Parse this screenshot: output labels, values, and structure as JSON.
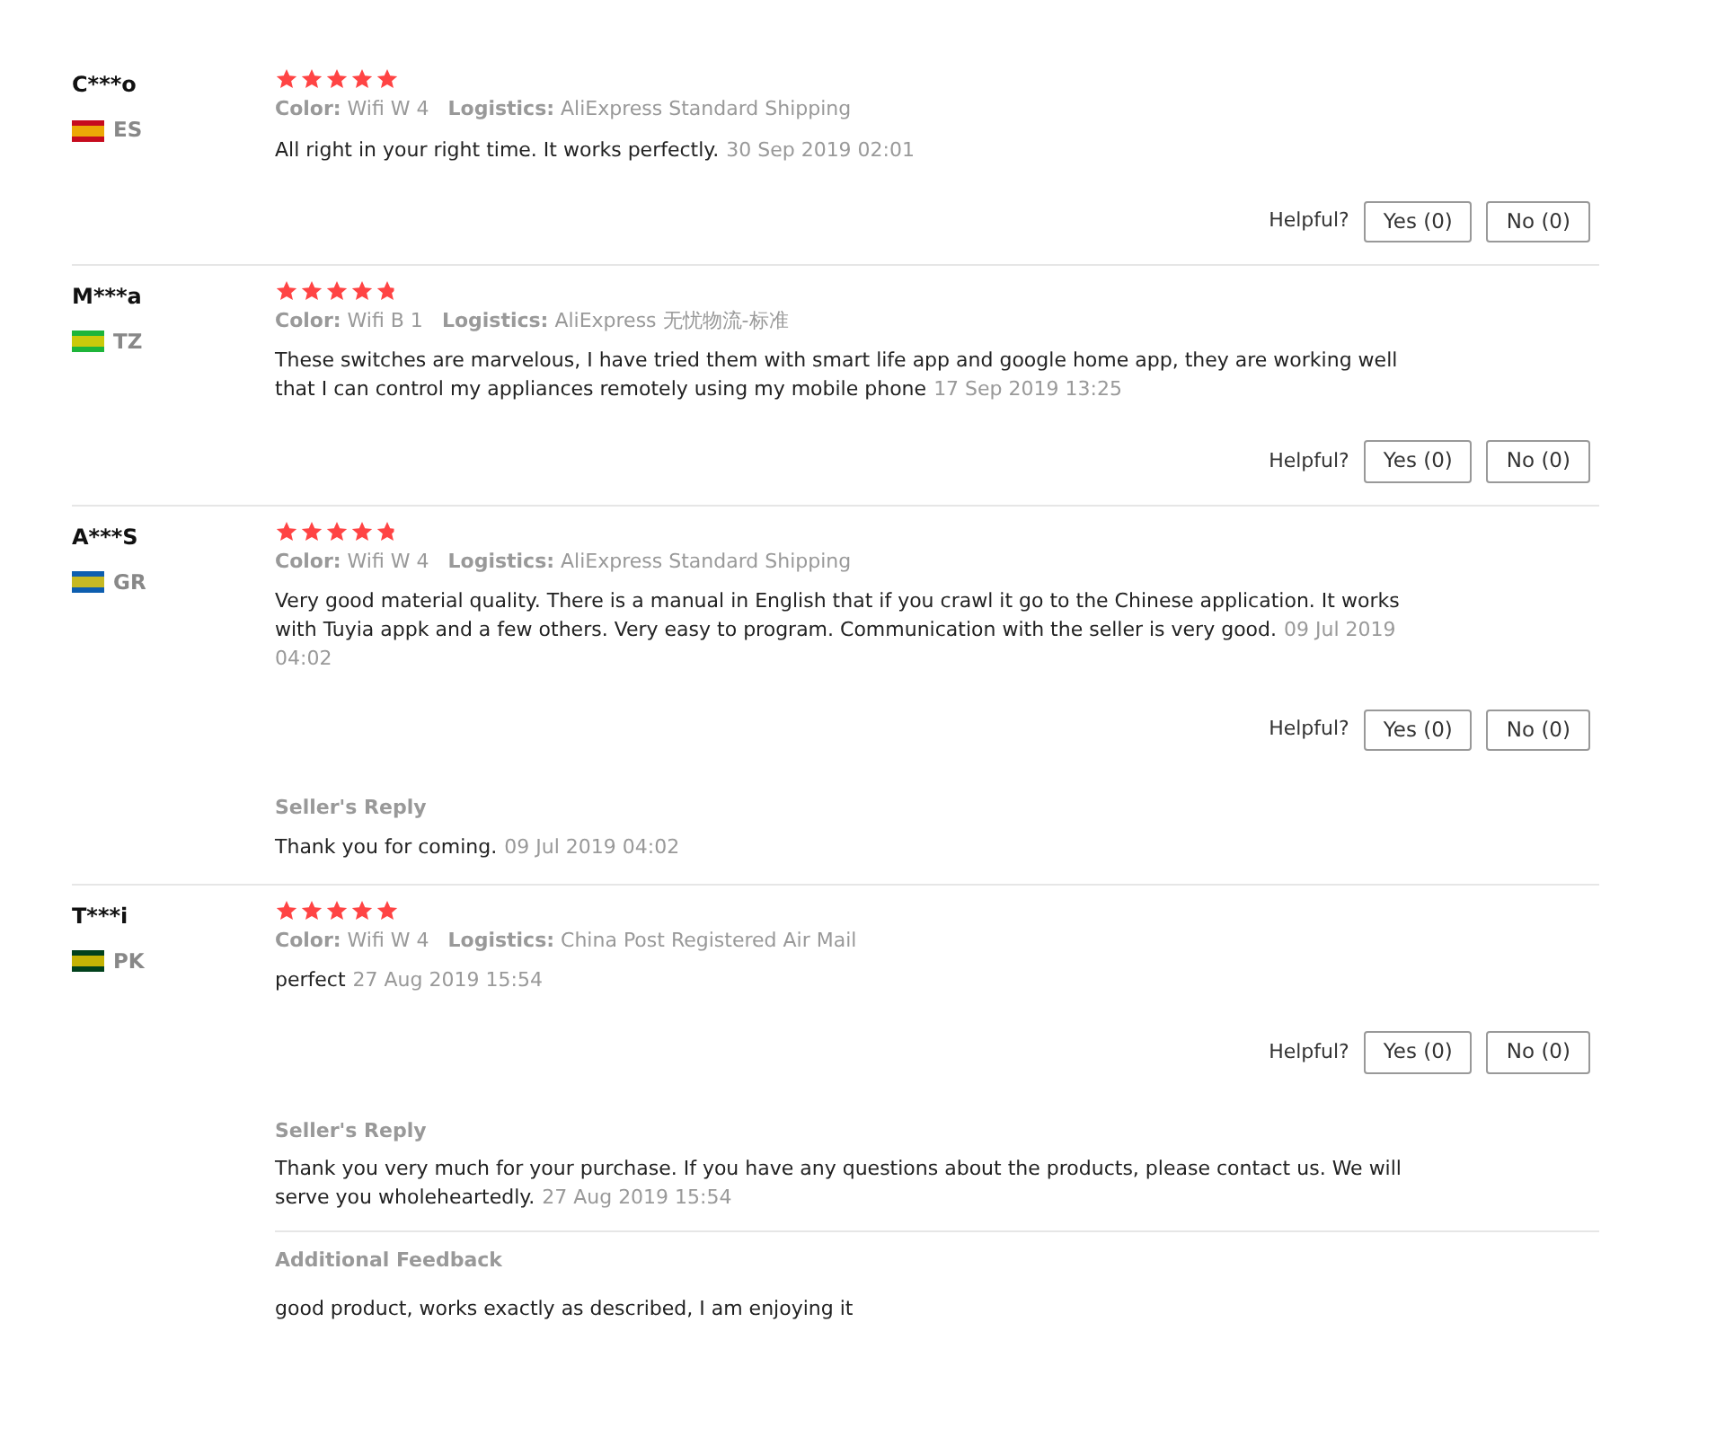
{
  "reviews": [
    {
      "reviewer": "C***o",
      "country": "ES",
      "color": "#c60b1e",
      "stars": 5,
      "color_label": "Color:",
      "color_value": "Wifi W 4",
      "logistics_label": "Logistics:",
      "logistics_value": "AliExpress Standard Shipping",
      "text": "All right in your right time. It works perfectly.",
      "date": "30 Sep 2019 02:01",
      "helpful_label": "Helpful?",
      "yes": "Yes (0)",
      "no": "No (0)"
    },
    {
      "reviewer": "M***a",
      "country": "TZ",
      "color": "#1eb53a",
      "stars": 4.8,
      "color_label": "Color:",
      "color_value": "Wifi B 1",
      "logistics_label": "Logistics:",
      "logistics_value": "AliExpress 无忧物流-标准",
      "text": "These switches are marvelous, I have tried them with smart life app and google home app, they are working well that I can control my appliances remotely using my mobile phone",
      "date": "17 Sep 2019 13:25",
      "helpful_label": "Helpful?",
      "yes": "Yes (0)",
      "no": "No (0)"
    },
    {
      "reviewer": "A***S",
      "country": "GR",
      "color": "#0d5eaf",
      "stars": 4.8,
      "color_label": "Color:",
      "color_value": "Wifi W 4",
      "logistics_label": "Logistics:",
      "logistics_value": "AliExpress Standard Shipping",
      "text": "Very good material quality. There is a manual in English that if you crawl it go to the Chinese application. It works with Tuyia appk and a few others. Very easy to program. Communication with the seller is very good.",
      "date": "09 Jul 2019 04:02",
      "helpful_label": "Helpful?",
      "yes": "Yes (0)",
      "no": "No (0)",
      "seller_reply": {
        "title": "Seller's Reply",
        "text": "Thank you for coming.",
        "date": "09 Jul 2019 04:02"
      }
    },
    {
      "reviewer": "T***i",
      "country": "PK",
      "color": "#01411c",
      "stars": 5,
      "color_label": "Color:",
      "color_value": "Wifi W 4",
      "logistics_label": "Logistics:",
      "logistics_value": "China Post Registered Air Mail",
      "text": "perfect",
      "date": "27 Aug 2019 15:54",
      "helpful_label": "Helpful?",
      "yes": "Yes (0)",
      "no": "No (0)",
      "seller_reply": {
        "title": "Seller's Reply",
        "text": "Thank you very much for your purchase. If you have any questions about the products, please contact us. We will serve you wholeheartedly.",
        "date": "27 Aug 2019 15:54"
      },
      "additional_feedback": {
        "title": "Additional Feedback",
        "text": "good product, works exactly as described, I am enjoying it"
      }
    }
  ]
}
